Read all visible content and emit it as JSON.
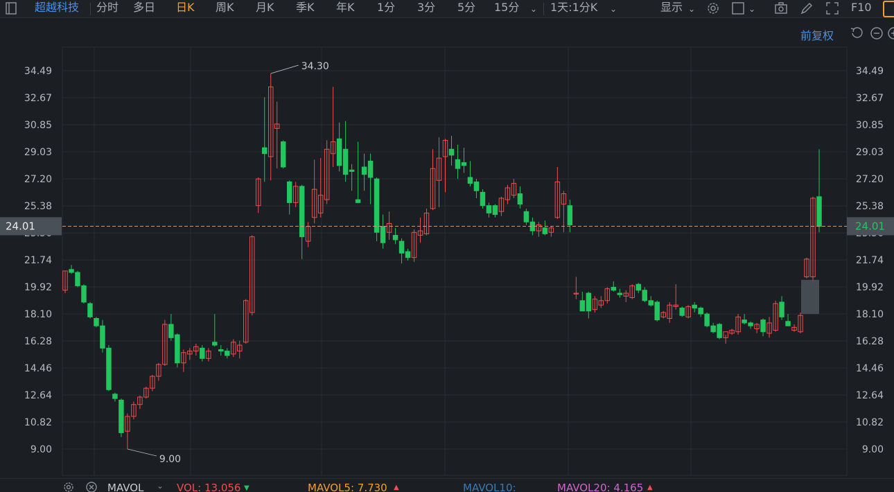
{
  "toolbar": {
    "stock_name": "超越科技",
    "periods": [
      "分时",
      "多日",
      "日K",
      "周K",
      "月K",
      "季K",
      "年K",
      "1分",
      "3分",
      "5分",
      "15分"
    ],
    "active_period": "日K",
    "multi_label": "1天:1分K",
    "display_label": "显示",
    "f10_label": "F10"
  },
  "subbar": {
    "adjust_label": "前复权"
  },
  "colors": {
    "up": "#ef4f4f",
    "down": "#22c55e",
    "accent": "#4a90e2",
    "active": "#f0a030",
    "grid": "#2a2f36",
    "price_line": "#c89a80"
  },
  "volume_bar": {
    "indicator": "MAVOL",
    "vol_label": "VOL: 13.056",
    "mavol5_label": "MAVOL5: 7.730",
    "mavol10_label": "MAVOL10:",
    "mavol20_label": "MAVOL20: 4.165"
  },
  "chart_data": {
    "type": "candlestick",
    "y_ticks": [
      "34.49",
      "32.67",
      "30.85",
      "29.03",
      "27.20",
      "25.38",
      "23.56",
      "21.74",
      "19.92",
      "18.10",
      "16.28",
      "14.46",
      "12.64",
      "10.82",
      "9.00"
    ],
    "ylim": [
      9.0,
      34.49
    ],
    "current_price": "24.01",
    "high_label": "34.30",
    "low_label": "9.00",
    "candles": [
      {
        "o": 19.7,
        "h": 21.0,
        "l": 19.5,
        "c": 21.0
      },
      {
        "o": 21.1,
        "h": 21.4,
        "l": 20.8,
        "c": 20.9
      },
      {
        "o": 20.9,
        "h": 21.0,
        "l": 19.9,
        "c": 20.0
      },
      {
        "o": 20.0,
        "h": 20.1,
        "l": 18.8,
        "c": 18.9
      },
      {
        "o": 18.8,
        "h": 18.9,
        "l": 17.8,
        "c": 17.9
      },
      {
        "o": 17.8,
        "h": 17.9,
        "l": 17.2,
        "c": 17.3
      },
      {
        "o": 17.3,
        "h": 17.7,
        "l": 15.5,
        "c": 15.8
      },
      {
        "o": 15.8,
        "h": 16.0,
        "l": 12.9,
        "c": 13.0
      },
      {
        "o": 12.7,
        "h": 12.8,
        "l": 12.2,
        "c": 12.4
      },
      {
        "o": 12.3,
        "h": 12.4,
        "l": 9.8,
        "c": 10.1
      },
      {
        "o": 10.2,
        "h": 11.4,
        "l": 9.0,
        "c": 11.2
      },
      {
        "o": 11.2,
        "h": 12.2,
        "l": 11.0,
        "c": 12.0
      },
      {
        "o": 12.0,
        "h": 12.6,
        "l": 11.7,
        "c": 12.5
      },
      {
        "o": 12.5,
        "h": 13.2,
        "l": 12.4,
        "c": 13.1
      },
      {
        "o": 13.1,
        "h": 14.0,
        "l": 12.9,
        "c": 13.9
      },
      {
        "o": 13.9,
        "h": 14.8,
        "l": 13.6,
        "c": 14.7
      },
      {
        "o": 14.7,
        "h": 17.7,
        "l": 14.6,
        "c": 17.4
      },
      {
        "o": 17.4,
        "h": 18.1,
        "l": 16.3,
        "c": 16.5
      },
      {
        "o": 16.7,
        "h": 16.8,
        "l": 14.5,
        "c": 14.8
      },
      {
        "o": 14.8,
        "h": 15.7,
        "l": 14.2,
        "c": 15.5
      },
      {
        "o": 15.4,
        "h": 15.8,
        "l": 15.0,
        "c": 15.6
      },
      {
        "o": 15.6,
        "h": 16.1,
        "l": 15.3,
        "c": 15.9
      },
      {
        "o": 15.8,
        "h": 16.0,
        "l": 14.9,
        "c": 15.1
      },
      {
        "o": 15.1,
        "h": 15.8,
        "l": 14.9,
        "c": 15.6
      },
      {
        "o": 16.2,
        "h": 18.1,
        "l": 15.9,
        "c": 16.0
      },
      {
        "o": 15.7,
        "h": 16.0,
        "l": 15.3,
        "c": 15.6
      },
      {
        "o": 15.6,
        "h": 15.8,
        "l": 15.1,
        "c": 15.3
      },
      {
        "o": 15.4,
        "h": 16.4,
        "l": 15.2,
        "c": 16.2
      },
      {
        "o": 15.6,
        "h": 16.3,
        "l": 15.1,
        "c": 16.0
      },
      {
        "o": 16.2,
        "h": 19.1,
        "l": 16.1,
        "c": 19.0
      },
      {
        "o": 18.2,
        "h": 23.4,
        "l": 18.0,
        "c": 23.3
      },
      {
        "o": 25.4,
        "h": 27.3,
        "l": 24.9,
        "c": 27.2
      },
      {
        "o": 29.3,
        "h": 32.7,
        "l": 27.0,
        "c": 28.9
      },
      {
        "o": 28.7,
        "h": 34.3,
        "l": 27.1,
        "c": 33.4
      },
      {
        "o": 30.6,
        "h": 32.4,
        "l": 27.9,
        "c": 30.9
      },
      {
        "o": 29.7,
        "h": 29.8,
        "l": 27.9,
        "c": 28.0
      },
      {
        "o": 27.0,
        "h": 27.1,
        "l": 24.8,
        "c": 25.6
      },
      {
        "o": 25.6,
        "h": 27.0,
        "l": 25.3,
        "c": 26.7
      },
      {
        "o": 26.7,
        "h": 26.8,
        "l": 21.8,
        "c": 23.3
      },
      {
        "o": 23.0,
        "h": 24.3,
        "l": 22.6,
        "c": 24.0
      },
      {
        "o": 24.6,
        "h": 28.5,
        "l": 24.2,
        "c": 26.5
      },
      {
        "o": 24.9,
        "h": 28.6,
        "l": 24.6,
        "c": 26.1
      },
      {
        "o": 25.8,
        "h": 29.8,
        "l": 25.5,
        "c": 29.2
      },
      {
        "o": 28.9,
        "h": 33.4,
        "l": 28.0,
        "c": 29.7
      },
      {
        "o": 29.9,
        "h": 31.0,
        "l": 27.7,
        "c": 28.1
      },
      {
        "o": 29.2,
        "h": 31.1,
        "l": 27.0,
        "c": 27.5
      },
      {
        "o": 27.8,
        "h": 28.2,
        "l": 26.4,
        "c": 27.7
      },
      {
        "o": 25.8,
        "h": 29.7,
        "l": 25.6,
        "c": 25.6
      },
      {
        "o": 28.0,
        "h": 28.9,
        "l": 26.4,
        "c": 27.5
      },
      {
        "o": 28.4,
        "h": 28.9,
        "l": 25.5,
        "c": 27.3
      },
      {
        "o": 27.2,
        "h": 27.3,
        "l": 23.0,
        "c": 23.6
      },
      {
        "o": 24.0,
        "h": 24.8,
        "l": 22.5,
        "c": 22.9
      },
      {
        "o": 23.6,
        "h": 25.0,
        "l": 23.1,
        "c": 24.2
      },
      {
        "o": 23.4,
        "h": 23.9,
        "l": 22.8,
        "c": 23.1
      },
      {
        "o": 23.0,
        "h": 23.2,
        "l": 21.5,
        "c": 22.2
      },
      {
        "o": 22.3,
        "h": 22.5,
        "l": 21.7,
        "c": 21.9
      },
      {
        "o": 21.9,
        "h": 23.8,
        "l": 21.6,
        "c": 23.6
      },
      {
        "o": 23.4,
        "h": 24.6,
        "l": 22.9,
        "c": 23.7
      },
      {
        "o": 23.5,
        "h": 25.2,
        "l": 23.4,
        "c": 24.9
      },
      {
        "o": 25.2,
        "h": 29.2,
        "l": 25.1,
        "c": 27.9
      },
      {
        "o": 27.1,
        "h": 30.0,
        "l": 25.3,
        "c": 28.6
      },
      {
        "o": 28.7,
        "h": 29.9,
        "l": 26.3,
        "c": 29.8
      },
      {
        "o": 29.2,
        "h": 30.1,
        "l": 28.1,
        "c": 28.8
      },
      {
        "o": 28.5,
        "h": 29.5,
        "l": 27.2,
        "c": 27.9
      },
      {
        "o": 28.3,
        "h": 29.3,
        "l": 27.6,
        "c": 28.1
      },
      {
        "o": 27.3,
        "h": 28.4,
        "l": 26.7,
        "c": 26.9
      },
      {
        "o": 27.0,
        "h": 27.2,
        "l": 25.9,
        "c": 26.4
      },
      {
        "o": 26.3,
        "h": 26.5,
        "l": 25.2,
        "c": 25.4
      },
      {
        "o": 25.4,
        "h": 25.6,
        "l": 24.6,
        "c": 24.9
      },
      {
        "o": 25.4,
        "h": 25.5,
        "l": 24.6,
        "c": 24.8
      },
      {
        "o": 25.0,
        "h": 26.0,
        "l": 24.7,
        "c": 25.9
      },
      {
        "o": 25.8,
        "h": 26.8,
        "l": 25.5,
        "c": 26.6
      },
      {
        "o": 26.1,
        "h": 27.2,
        "l": 25.9,
        "c": 26.9
      },
      {
        "o": 26.2,
        "h": 26.7,
        "l": 25.2,
        "c": 25.5
      },
      {
        "o": 25.0,
        "h": 25.2,
        "l": 24.1,
        "c": 24.3
      },
      {
        "o": 24.3,
        "h": 24.6,
        "l": 23.4,
        "c": 23.7
      },
      {
        "o": 23.7,
        "h": 24.3,
        "l": 23.3,
        "c": 24.1
      },
      {
        "o": 23.9,
        "h": 24.4,
        "l": 23.4,
        "c": 23.5
      },
      {
        "o": 23.6,
        "h": 24.0,
        "l": 23.3,
        "c": 23.9
      },
      {
        "o": 24.6,
        "h": 28.0,
        "l": 24.5,
        "c": 27.0
      },
      {
        "o": 25.5,
        "h": 26.4,
        "l": 23.6,
        "c": 26.2
      },
      {
        "o": 25.4,
        "h": 25.8,
        "l": 23.6,
        "c": 24.1
      },
      {
        "o": 19.5,
        "h": 20.6,
        "l": 19.1,
        "c": 19.5
      },
      {
        "o": 19.0,
        "h": 19.6,
        "l": 18.3,
        "c": 18.3
      },
      {
        "o": 19.5,
        "h": 19.6,
        "l": 17.8,
        "c": 18.3
      },
      {
        "o": 18.4,
        "h": 19.3,
        "l": 18.2,
        "c": 19.1
      },
      {
        "o": 18.7,
        "h": 19.3,
        "l": 18.5,
        "c": 19.0
      },
      {
        "o": 19.0,
        "h": 19.9,
        "l": 18.8,
        "c": 19.8
      },
      {
        "o": 19.9,
        "h": 20.3,
        "l": 19.6,
        "c": 19.7
      },
      {
        "o": 19.5,
        "h": 19.8,
        "l": 19.2,
        "c": 19.4
      },
      {
        "o": 19.3,
        "h": 19.7,
        "l": 18.9,
        "c": 19.5
      },
      {
        "o": 19.2,
        "h": 20.1,
        "l": 19.1,
        "c": 20.0
      },
      {
        "o": 20.1,
        "h": 20.2,
        "l": 19.5,
        "c": 19.7
      },
      {
        "o": 19.7,
        "h": 19.9,
        "l": 18.9,
        "c": 19.0
      },
      {
        "o": 19.0,
        "h": 19.3,
        "l": 18.6,
        "c": 18.7
      },
      {
        "o": 18.9,
        "h": 19.0,
        "l": 17.6,
        "c": 17.7
      },
      {
        "o": 17.9,
        "h": 18.3,
        "l": 17.8,
        "c": 18.2
      },
      {
        "o": 17.8,
        "h": 18.9,
        "l": 17.5,
        "c": 18.7
      },
      {
        "o": 18.6,
        "h": 20.1,
        "l": 18.4,
        "c": 18.7
      },
      {
        "o": 18.5,
        "h": 18.6,
        "l": 17.9,
        "c": 18.0
      },
      {
        "o": 17.9,
        "h": 18.7,
        "l": 17.8,
        "c": 18.6
      },
      {
        "o": 18.7,
        "h": 18.9,
        "l": 18.2,
        "c": 18.5
      },
      {
        "o": 18.5,
        "h": 18.6,
        "l": 17.9,
        "c": 18.1
      },
      {
        "o": 18.1,
        "h": 18.2,
        "l": 17.2,
        "c": 17.3
      },
      {
        "o": 17.3,
        "h": 17.5,
        "l": 16.8,
        "c": 16.9
      },
      {
        "o": 17.4,
        "h": 17.5,
        "l": 16.4,
        "c": 16.5
      },
      {
        "o": 16.5,
        "h": 16.7,
        "l": 16.1,
        "c": 16.9
      },
      {
        "o": 16.8,
        "h": 17.1,
        "l": 16.7,
        "c": 17.0
      },
      {
        "o": 16.9,
        "h": 18.1,
        "l": 16.7,
        "c": 17.9
      },
      {
        "o": 17.7,
        "h": 18.1,
        "l": 17.4,
        "c": 17.5
      },
      {
        "o": 17.5,
        "h": 17.6,
        "l": 17.1,
        "c": 17.3
      },
      {
        "o": 17.1,
        "h": 17.5,
        "l": 16.8,
        "c": 17.4
      },
      {
        "o": 17.7,
        "h": 17.8,
        "l": 16.6,
        "c": 16.9
      },
      {
        "o": 16.8,
        "h": 17.9,
        "l": 16.5,
        "c": 17.5
      },
      {
        "o": 17.0,
        "h": 19.0,
        "l": 16.9,
        "c": 18.8
      },
      {
        "o": 18.9,
        "h": 19.3,
        "l": 17.7,
        "c": 17.9
      },
      {
        "o": 17.6,
        "h": 18.1,
        "l": 17.3,
        "c": 17.3
      },
      {
        "o": 17.0,
        "h": 17.4,
        "l": 16.9,
        "c": 17.2
      },
      {
        "o": 16.9,
        "h": 18.2,
        "l": 16.8,
        "c": 18.0
      },
      {
        "o": 20.6,
        "h": 21.9,
        "l": 20.5,
        "c": 21.8
      },
      {
        "o": 20.6,
        "h": 26.0,
        "l": 20.2,
        "c": 25.9
      },
      {
        "o": 26.0,
        "h": 29.2,
        "l": 23.6,
        "c": 24.0
      }
    ]
  }
}
